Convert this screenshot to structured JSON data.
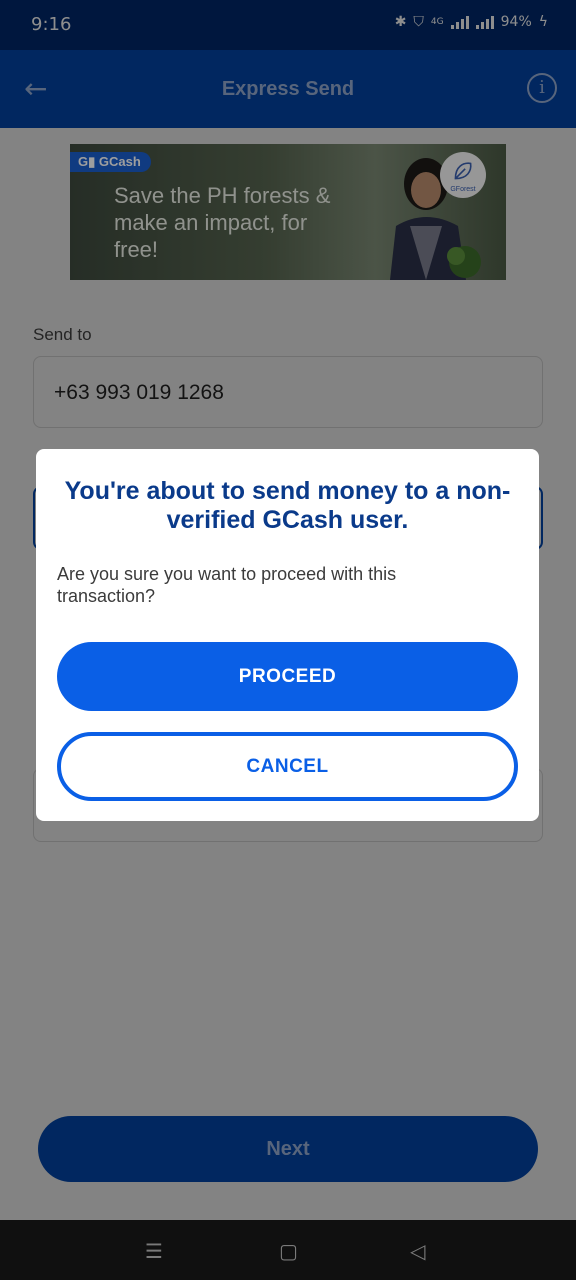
{
  "status_bar": {
    "time": "9:16",
    "network": "4G",
    "battery": "94%"
  },
  "header": {
    "title": "Express Send",
    "back_icon": "arrow-left-icon",
    "info_icon": "info-icon"
  },
  "banner": {
    "brand": "GCash",
    "headline": "Save the PH forests & make an impact, for free!",
    "badge": "GForest"
  },
  "form": {
    "send_to_label": "Send to",
    "send_to_value": "+63 993 019 1268"
  },
  "dialog": {
    "title": "You're about to send money to a non-verified GCash user.",
    "message": "Are you sure you want to proceed with this transaction?",
    "proceed_label": "PROCEED",
    "cancel_label": "CANCEL"
  },
  "footer": {
    "next_label": "Next"
  },
  "colors": {
    "primary": "#0a5fe6",
    "header": "#02409b",
    "status": "#002664",
    "dialog_title": "#0a3a8a"
  }
}
